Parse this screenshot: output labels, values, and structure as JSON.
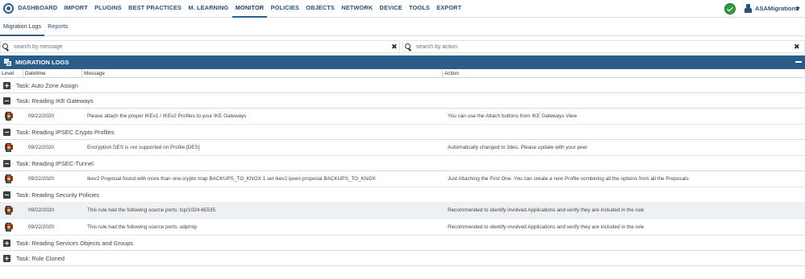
{
  "nav": {
    "items": [
      "DASHBOARD",
      "IMPORT",
      "PLUGINS",
      "BEST PRACTICES",
      "M. LEARNING",
      "MONITOR",
      "POLICIES",
      "OBJECTS",
      "NETWORK",
      "DEVICE",
      "TOOLS",
      "EXPORT"
    ],
    "active": "MONITOR",
    "user": "ASAMigration2",
    "status_icon": "check-circle-icon",
    "accent": "#2d5f8e"
  },
  "subtabs": {
    "migration_logs": "Migration Logs",
    "reports": "Reports"
  },
  "search": {
    "message_placeholder": "search by message",
    "action_placeholder": "search by action"
  },
  "panel": {
    "title": "MIGRATION LOGS",
    "header_color": "#2b5d89"
  },
  "table": {
    "columns": {
      "level": "Level",
      "datetime": "Datetime",
      "message": "Message",
      "action": "Action"
    },
    "tasks": [
      {
        "label": "Task: Auto Zone Assign",
        "expanded": false,
        "logs": []
      },
      {
        "label": "Task: Reading IKE Gateways",
        "expanded": true,
        "logs": [
          {
            "date": "09/22/2020",
            "message": "Please attach the proper IKEv1 / IKEv2 Profiles to your IKE Gateways",
            "action": "You can use the Attach buttons from IKE Gateways View"
          }
        ]
      },
      {
        "label": "Task: Reading IPSEC Crypto Profiles",
        "expanded": true,
        "logs": [
          {
            "date": "09/22/2020",
            "message": "Encryption DES is not supported on Profile [DES]",
            "action": "Automatically changed to 3des. Please update with your peer"
          }
        ]
      },
      {
        "label": "Task: Reading IPSEC-Tunnel",
        "expanded": true,
        "logs": [
          {
            "date": "09/22/2020",
            "message": "Ikev2 Proposal found with more than one:crypto map BACKUPS_TO_KNOX 1 set ikev2 ipsec-proposal BACKUPS_TO_KNOX",
            "action": "Just Attaching the First One. You can create a new Profile combining all the options from all the Proposals"
          }
        ]
      },
      {
        "label": "Task: Reading Security Policies",
        "expanded": true,
        "logs": [
          {
            "date": "09/22/2020",
            "message": "This rule had the following source ports: tcp/1024-65535",
            "action": "Recommended to identify involved Applications and verify they are included in the rule"
          },
          {
            "date": "09/22/2020",
            "message": "This rule had the following source ports: udp/ntp",
            "action": "Recommended to identify involved Applications and verify they are included in the rule"
          }
        ]
      },
      {
        "label": "Task: Reading Services Objects and Groups",
        "expanded": false,
        "logs": []
      },
      {
        "label": "Task: Rule Cloned",
        "expanded": false,
        "logs": []
      }
    ]
  }
}
